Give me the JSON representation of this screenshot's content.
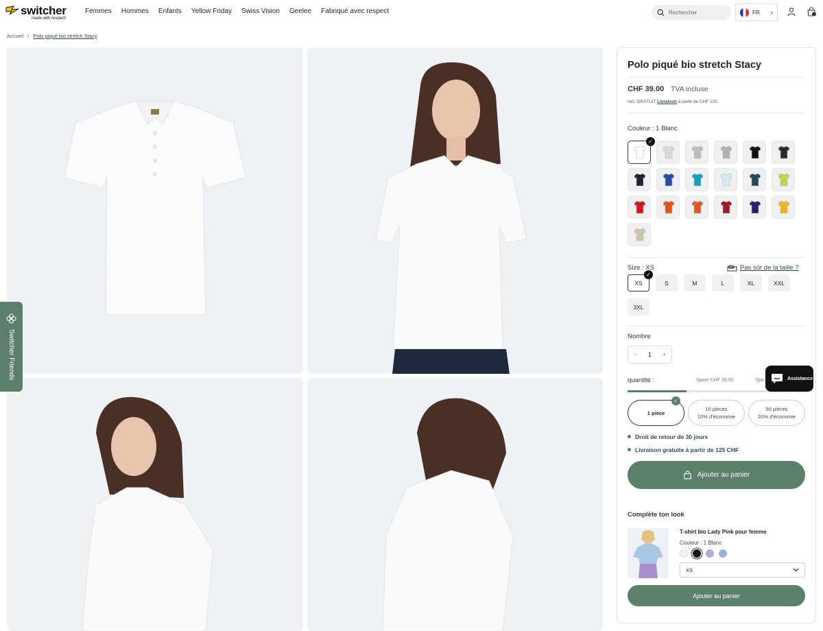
{
  "brand": {
    "name": "switcher",
    "tagline": "made with respect!"
  },
  "nav": [
    "Femmes",
    "Hommes",
    "Enfants",
    "Yellow Friday",
    "Swiss Vision",
    "Geelee",
    "Fabriqué avec respect"
  ],
  "search": {
    "placeholder": "Rechercher"
  },
  "language": {
    "code": "FR"
  },
  "cart_count": "0",
  "breadcrumb": {
    "home": "Accueil",
    "separator": "/",
    "current": "Polo piqué bio stretch Stacy"
  },
  "side_tab": {
    "label": "Switcher Friends"
  },
  "product": {
    "title": "Polo piqué bio stretch Stacy",
    "price": "CHF 39.00",
    "tax_note": "TVA incluse",
    "shipping_prefix": "incl. GRATUIT",
    "shipping_link": "Livraison",
    "shipping_suffix": "à partir de CHF 125",
    "color_label": "Couleur : 1 Blanc",
    "colors": [
      {
        "name": "Blanc",
        "hex": "#ffffff"
      },
      {
        "name": "Gris clair",
        "hex": "#d9d9d9"
      },
      {
        "name": "Gris",
        "hex": "#bdbdbd"
      },
      {
        "name": "Gris chiné",
        "hex": "#b0b0b0"
      },
      {
        "name": "Noir",
        "hex": "#111111"
      },
      {
        "name": "Anthracite",
        "hex": "#2a2a2a"
      },
      {
        "name": "Marine",
        "hex": "#1c2233"
      },
      {
        "name": "Bleu royal",
        "hex": "#2c4aa8"
      },
      {
        "name": "Turquoise",
        "hex": "#1b9cc4"
      },
      {
        "name": "Bleu ciel",
        "hex": "#d6eaf2"
      },
      {
        "name": "Pétrole",
        "hex": "#274a5a"
      },
      {
        "name": "Lime",
        "hex": "#b8d94a"
      },
      {
        "name": "Rouge",
        "hex": "#d6141d"
      },
      {
        "name": "Orange",
        "hex": "#e0541f"
      },
      {
        "name": "Orange foncé",
        "hex": "#dd5a25"
      },
      {
        "name": "Bordeaux",
        "hex": "#9c1a24"
      },
      {
        "name": "Violet",
        "hex": "#2f1c6b"
      },
      {
        "name": "Jaune",
        "hex": "#f2b51f"
      },
      {
        "name": "Beige",
        "hex": "#cfc3ad"
      }
    ],
    "size_label": "Size : XS",
    "size_help": "Pas sûr de la taille ?",
    "sizes": [
      "XS",
      "S",
      "M",
      "L",
      "XL",
      "XXL",
      "3XL"
    ],
    "quantity_label": "Nombre",
    "quantity": {
      "minus": "−",
      "value": "1",
      "plus": "+"
    },
    "bundle_label": "quantité :",
    "bundle_save": "Spare CHF 39.00",
    "bundle_save_cut": "Spa",
    "bundles": [
      {
        "line1": "1 pièce",
        "line2": ""
      },
      {
        "line1": "10 pièces",
        "line2": "10% d'économie"
      },
      {
        "line1": "50 pièces",
        "line2": "20% d'économie"
      }
    ],
    "perks": [
      "Droit de retour de 30 jours",
      "Livraison gratuite à partir de 125 CHF"
    ],
    "add_to_cart": "Ajouter au panier"
  },
  "chat": {
    "label": "Assistance"
  },
  "complete_look": {
    "heading": "Complète ton look",
    "item_title": "T-shirt bio Lady Pink pour femme",
    "item_color": "Couleur : 1 Blanc",
    "item_colors": [
      "#f3f3f3",
      "#111111",
      "#b7a8d8",
      "#9bb3d0"
    ],
    "size_value": "XS",
    "button": "Ajouter au panier"
  },
  "accent": "#5b7f6a"
}
